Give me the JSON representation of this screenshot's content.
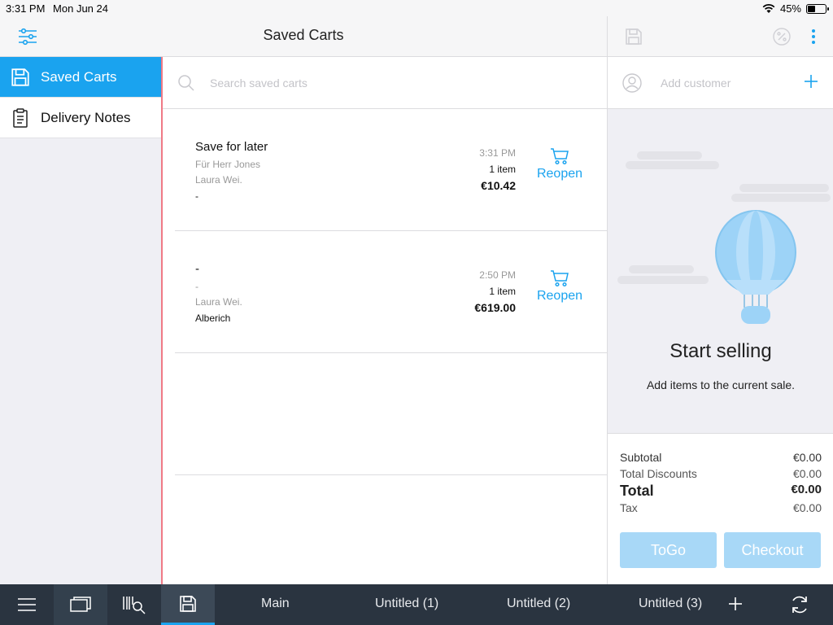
{
  "status_bar": {
    "time": "3:31 PM",
    "date": "Mon Jun 24",
    "battery": "45%"
  },
  "header": {
    "title": "Saved Carts"
  },
  "sidebar": {
    "items": [
      {
        "label": "Saved Carts",
        "icon": "floppy-disk-icon",
        "active": true
      },
      {
        "label": "Delivery Notes",
        "icon": "clipboard-icon",
        "active": false
      }
    ]
  },
  "search": {
    "placeholder": "Search saved carts",
    "value": ""
  },
  "carts": [
    {
      "name": "Save for later",
      "note": "Für Herr Jones",
      "user": "Laura Wei.",
      "customer": "-",
      "time": "3:31 PM",
      "items": "1 item",
      "total": "€10.42",
      "action": "Reopen"
    },
    {
      "name": "-",
      "note": "-",
      "user": "Laura Wei.",
      "customer": "Alberich",
      "time": "2:50 PM",
      "items": "1 item",
      "total": "€619.00",
      "action": "Reopen"
    }
  ],
  "customer": {
    "placeholder": "Add customer"
  },
  "empty_state": {
    "title": "Start selling",
    "subtitle": "Add items to the current sale."
  },
  "totals": {
    "subtotal_label": "Subtotal",
    "subtotal": "€0.00",
    "discounts_label": "Total Discounts",
    "discounts": "€0.00",
    "total_label": "Total",
    "total": "€0.00",
    "tax_label": "Tax",
    "tax": "€0.00"
  },
  "buttons": {
    "togo": "ToGo",
    "checkout": "Checkout"
  },
  "bottom_tabs": [
    "Main",
    "Untitled (1)",
    "Untitled (2)",
    "Untitled (3)"
  ],
  "colors": {
    "accent": "#1aa3ef",
    "bottom_bar": "#2a3440",
    "button_disabled": "#a8d8f7",
    "sidebar_border": "#f07a86"
  }
}
